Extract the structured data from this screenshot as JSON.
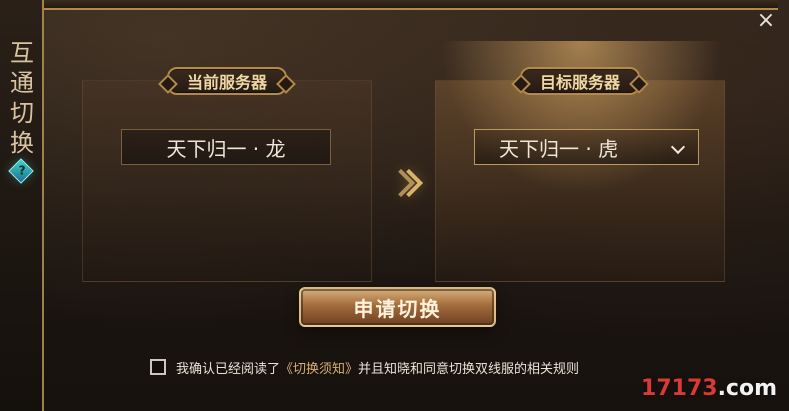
{
  "left_rail": {
    "title_chars": [
      "互",
      "通",
      "切",
      "换"
    ],
    "help_icon": "help-gem-icon"
  },
  "header": {
    "close_icon": "close-icon",
    "close_glyph": "×"
  },
  "current_server": {
    "label": "当前服务器",
    "value": "天下归一 · 龙"
  },
  "target_server": {
    "label": "目标服务器",
    "value": "天下归一 · 虎",
    "dropdown_icon": "chevron-down-icon"
  },
  "apply": {
    "label": "申请切换"
  },
  "agreement": {
    "prefix": "我确认已经阅读了",
    "link": "《切换须知》",
    "suffix": "并且知晓和同意切换双线服的相关规则"
  },
  "watermark": {
    "prefix": "17173",
    "suffix": ".com"
  }
}
